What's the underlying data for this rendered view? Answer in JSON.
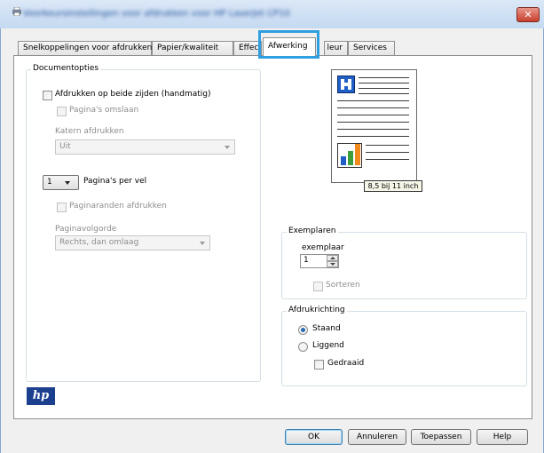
{
  "window": {
    "title": "Voorkeursinstellingen voor afdrukken voor HP LaserJet CP1025",
    "close_symbol": "✕"
  },
  "tabs": [
    {
      "label": "Snelkoppelingen voor afdrukken"
    },
    {
      "label": "Papier/kwaliteit"
    },
    {
      "label": "Effecte"
    },
    {
      "label": "Afwerking"
    },
    {
      "label": "leur"
    },
    {
      "label": "Services"
    }
  ],
  "document_options": {
    "legend": "Documentopties",
    "duplex_label": "Afdrukken op beide zijden (handmatig)",
    "flip_label": "Pagina's omslaan",
    "booklet_label": "Katern afdrukken",
    "booklet_value": "Uit",
    "pages_per_sheet_value": "1",
    "pages_per_sheet_label": "Pagina's per vel",
    "borders_label": "Paginaranden afdrukken",
    "order_label": "Paginavolgorde",
    "order_value": "Rechts, dan omlaag"
  },
  "preview": {
    "paper_size": "8,5 bij 11 inch"
  },
  "copies": {
    "legend": "Exemplaren",
    "label": "exemplaar",
    "value": "1",
    "collate_label": "Sorteren"
  },
  "orientation": {
    "legend": "Afdrukrichting",
    "portrait_label": "Staand",
    "landscape_label": "Liggend",
    "rotated_label": "Gedraaid",
    "selected": "Staand"
  },
  "footer": {
    "logo_text": "hp",
    "ok_label": "OK",
    "cancel_label": "Annuleren",
    "apply_label": "Toepassen",
    "help_label": "Help"
  },
  "colors": {
    "accent": "#2f9fe0",
    "radio_selected": "#2a6ab3",
    "hp_logo": "#1d3f8f",
    "chart_blue": "#1f5fc7",
    "chart_green": "#3ba03b",
    "chart_orange": "#f08a1c"
  }
}
